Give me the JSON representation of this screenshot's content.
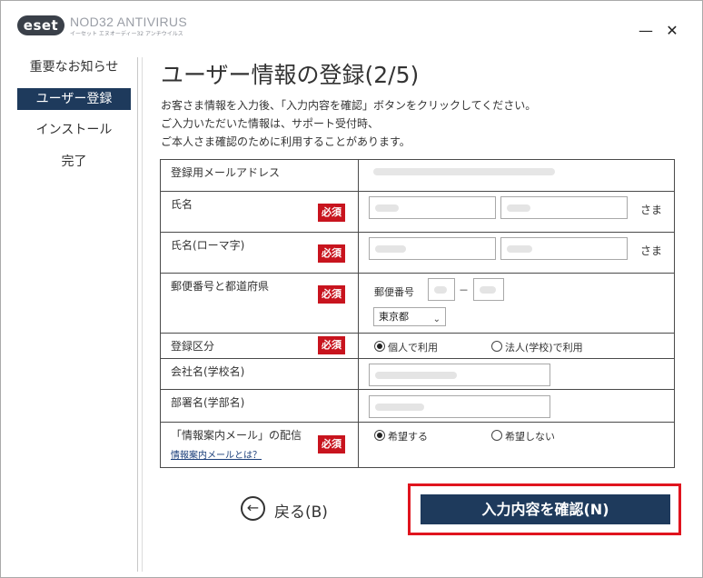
{
  "titlebar": {
    "logo": "eset",
    "product": "NOD32 ANTIVIRUS",
    "subproduct": "イーセット エヌオーディー32 アンチウイルス",
    "minimize": "—",
    "close": "✕"
  },
  "sidebar": {
    "items": [
      {
        "label": "重要なお知らせ",
        "active": false
      },
      {
        "label": "ユーザー登録",
        "active": true
      },
      {
        "label": "インストール",
        "active": false
      },
      {
        "label": "完了",
        "active": false
      }
    ]
  },
  "main": {
    "title": "ユーザー情報の登録(2/5)",
    "desc": [
      "お客さま情報を入力後、「入力内容を確認」ボタンをクリックしてください。",
      "ご入力いただいた情報は、サポート受付時、",
      "ご本人さま確認のために利用することがあります。"
    ]
  },
  "form": {
    "required_label": "必須",
    "email": {
      "label": "登録用メールアドレス"
    },
    "name": {
      "label": "氏名",
      "suffix": "さま"
    },
    "name_roman": {
      "label": "氏名(ローマ字)",
      "suffix": "さま"
    },
    "postal": {
      "label": "郵便番号と都道府県",
      "postal_label": "郵便番号",
      "dash": "－",
      "prefecture": "東京都"
    },
    "registration_type": {
      "label": "登録区分",
      "option_personal": "個人で利用",
      "option_corporate": "法人(学校)で利用",
      "selected": "personal"
    },
    "company": {
      "label": "会社名(学校名)"
    },
    "department": {
      "label": "部署名(学部名)"
    },
    "newsletter": {
      "label": "「情報案内メール」の配信",
      "help": "情報案内メールとは？",
      "option_yes": "希望する",
      "option_no": "希望しない",
      "selected": "yes"
    }
  },
  "buttons": {
    "back_icon": "←",
    "back": "戻る(B)",
    "confirm": "入力内容を確認(N)"
  },
  "colors": {
    "accent": "#1e3a5c",
    "required": "#c8141e",
    "highlight": "#e0141e"
  }
}
